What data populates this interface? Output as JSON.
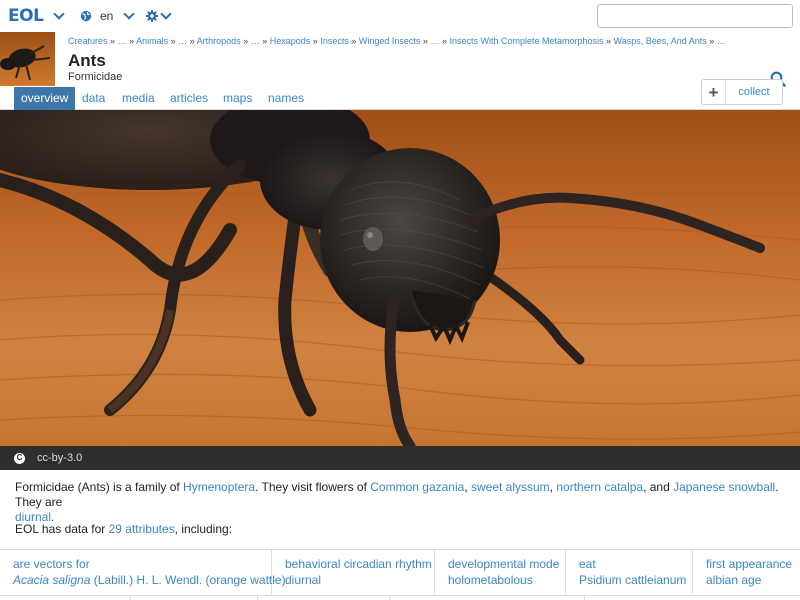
{
  "topbar": {
    "logo": "EOL",
    "language": "en",
    "search_placeholder": ""
  },
  "header": {
    "breadcrumb": [
      "Creatures",
      "…",
      "Animals",
      "…",
      "Arthropods",
      "…",
      "Hexapods",
      "Insects",
      "Winged Insects",
      "…",
      "Insects With Complete Metamorphosis",
      "Wasps, Bees, And Ants",
      "…"
    ],
    "title": "Ants",
    "subtitle": "Formicidae",
    "collect_plus": "+",
    "collect_label": "collect"
  },
  "tabs": [
    "overview",
    "data",
    "media",
    "articles",
    "maps",
    "names"
  ],
  "hero": {
    "license": "cc-by-3.0",
    "license_icon": "C"
  },
  "description": {
    "p1_a": "Formicidae (Ants) is a family of ",
    "hymenoptera": "Hymenoptera",
    "p1_b": ". They visit flowers of ",
    "common_gazania": "Common gazania",
    "comma1": ", ",
    "sweet_alyssum": "sweet alyssum",
    "comma2": ", ",
    "northern_catalpa": "northern catalpa",
    "and": ", and ",
    "japanese_snowball": "Japanese snowball",
    "p1_c": ". They are",
    "diurnal": "diurnal",
    "period": ".",
    "attrs_a": "EOL has data for ",
    "attrs_count": "29 attributes",
    "attrs_b": ", including:"
  },
  "traits": [
    {
      "label": "are vectors for",
      "value_italic": "Acacia saligna",
      "value_rest": " (Labill.) H. L. Wendl. (orange wattle)"
    },
    {
      "label": "behavioral circadian rhythm",
      "value": "diurnal"
    },
    {
      "label": "developmental mode",
      "value": "holometabolous"
    },
    {
      "label": "eat",
      "value": "Psidium cattleianum"
    },
    {
      "label": "first appearance",
      "value": "albian age"
    }
  ],
  "colors": {
    "link": "#3a86c8",
    "logo": "#2d6fb3",
    "tab_active": "#3d77a8",
    "caption_bar": "#2f2e2d"
  }
}
